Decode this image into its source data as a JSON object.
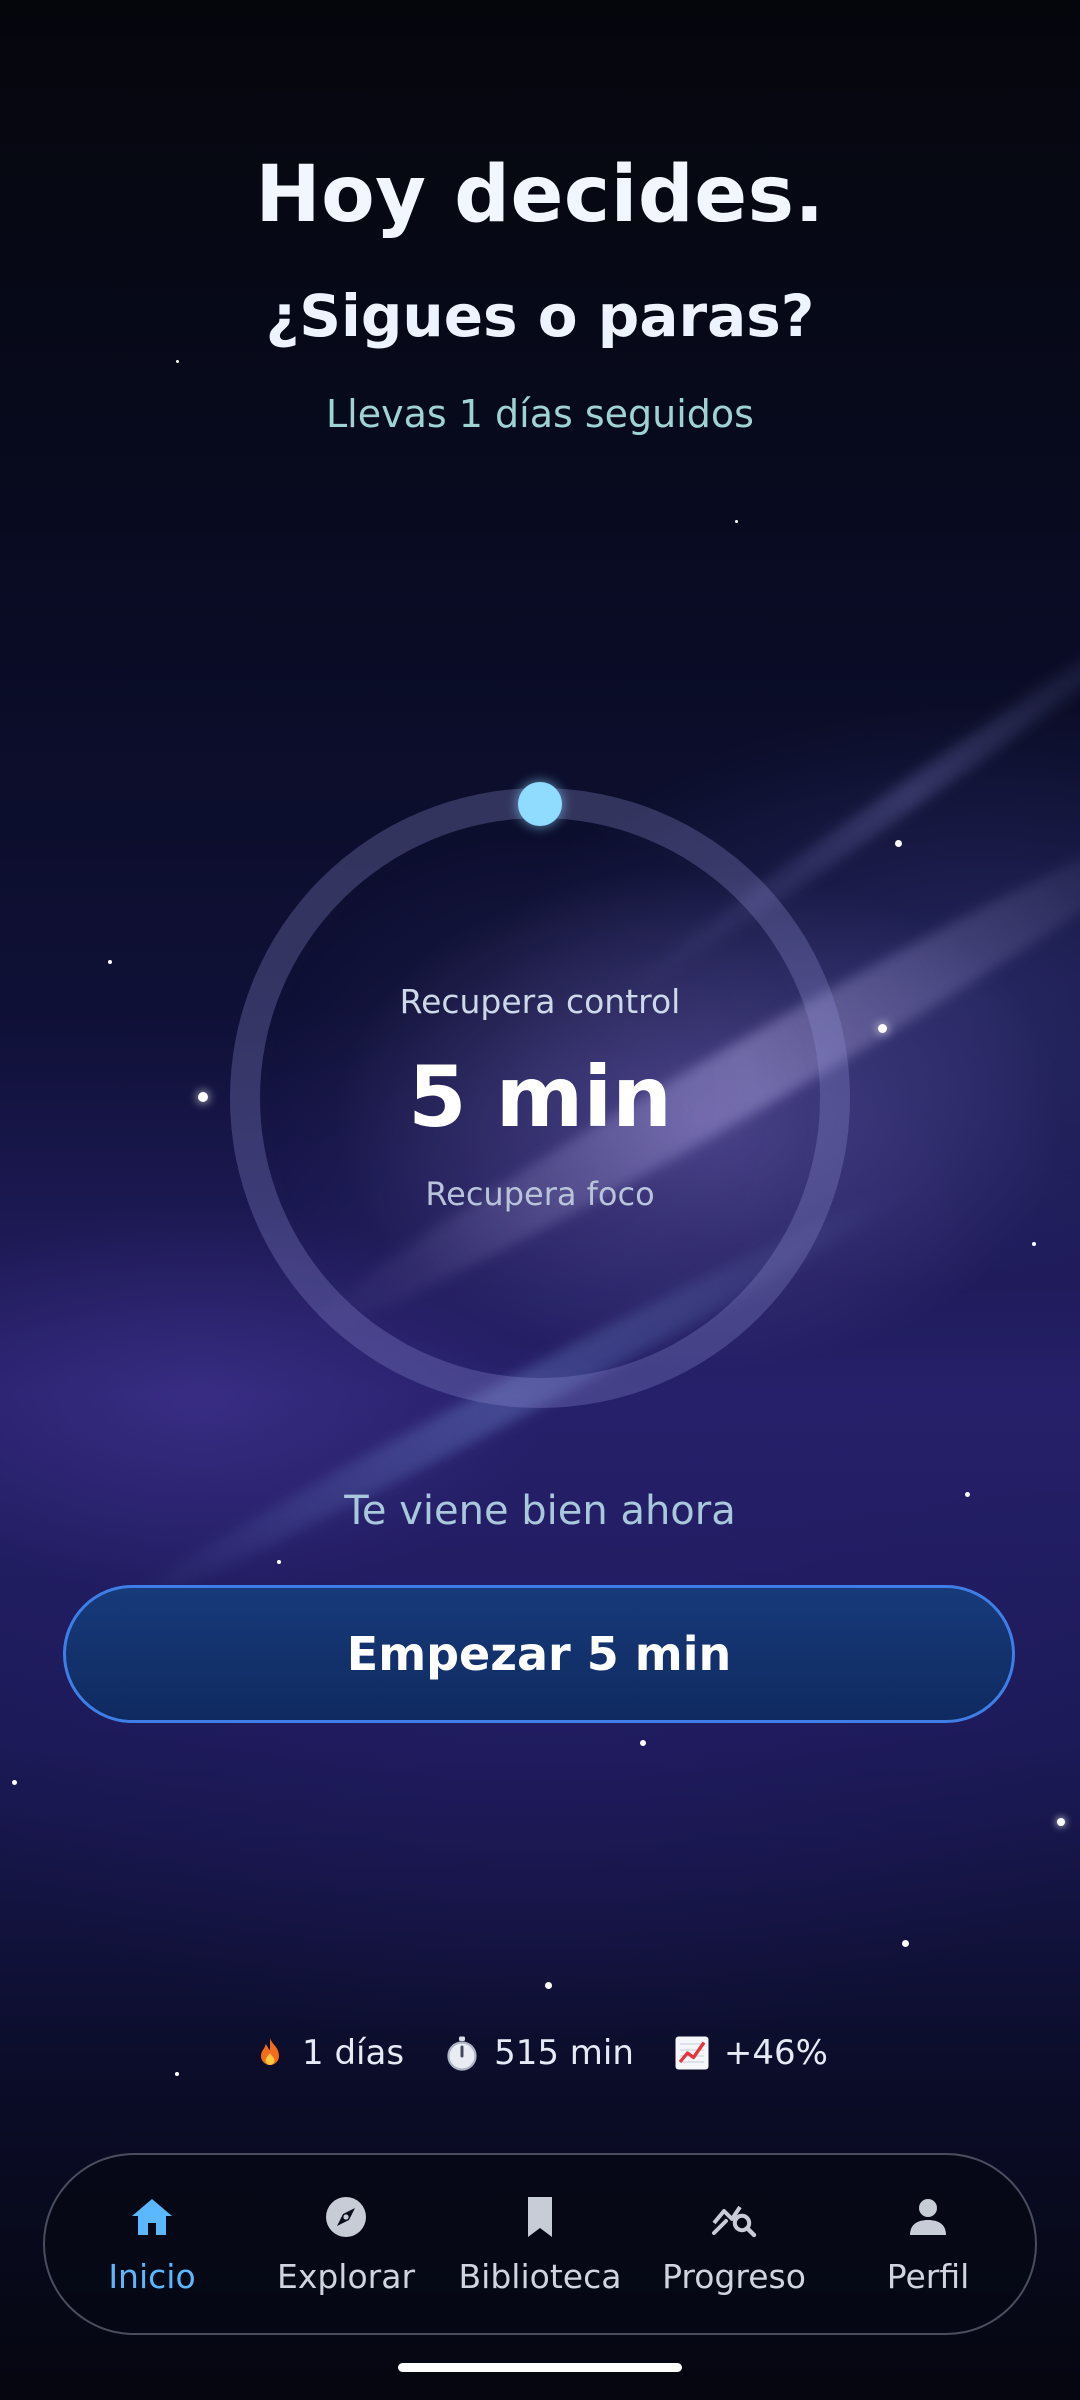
{
  "header": {
    "title": "Hoy decides.",
    "subtitle": "¿Sigues o paras?",
    "streak_text": "Llevas 1 días seguidos"
  },
  "timer": {
    "label": "Recupera control",
    "value": "5 min",
    "sublabel": "Recupera foco",
    "progress": 0
  },
  "hint": "Te viene bien ahora",
  "cta": {
    "label": "Empezar 5 min"
  },
  "stats": [
    {
      "icon": "fire-icon",
      "value": "1 días"
    },
    {
      "icon": "stopwatch-icon",
      "value": "515 min"
    },
    {
      "icon": "chart-increasing-icon",
      "value": "+46%"
    }
  ],
  "nav": {
    "items": [
      {
        "label": "Inicio",
        "icon": "home-icon",
        "active": true
      },
      {
        "label": "Explorar",
        "icon": "compass-icon",
        "active": false
      },
      {
        "label": "Biblioteca",
        "icon": "bookmark-icon",
        "active": false
      },
      {
        "label": "Progreso",
        "icon": "progress-search-icon",
        "active": false
      },
      {
        "label": "Perfil",
        "icon": "person-icon",
        "active": false
      }
    ]
  },
  "colors": {
    "accent": "#5bb8ff",
    "knob": "#8fdcff",
    "cta_border": "#3e7ee6",
    "cta_fill": "#173a7a"
  }
}
